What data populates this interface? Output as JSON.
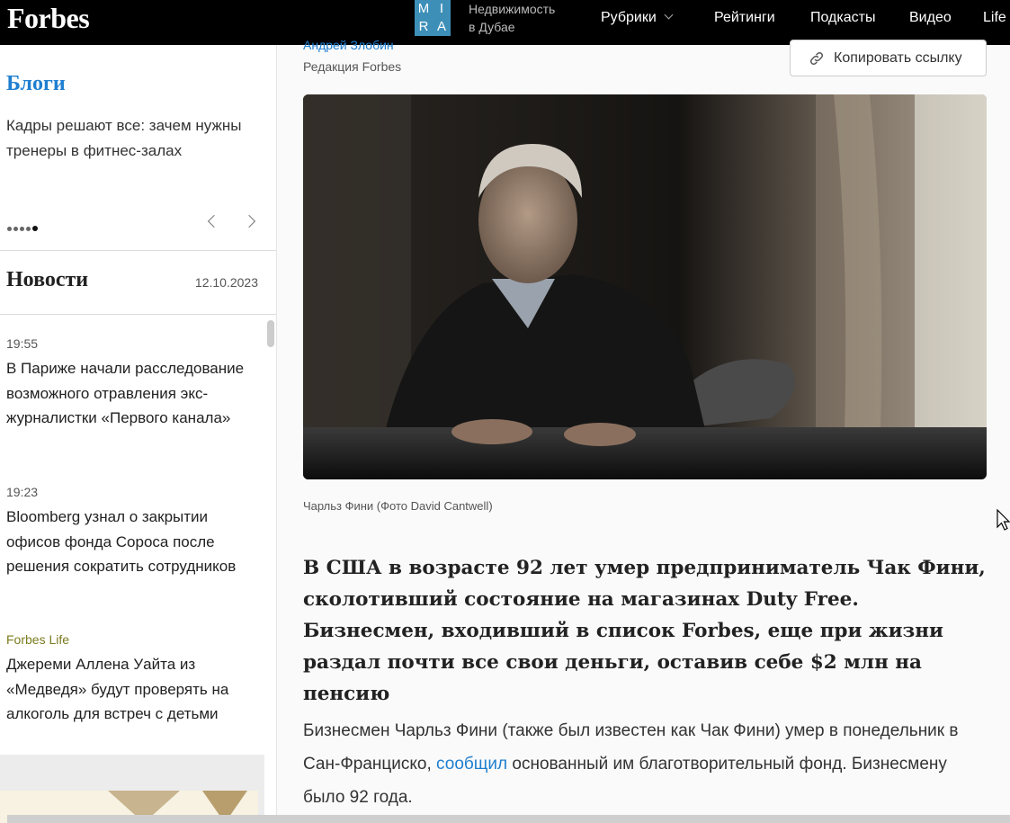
{
  "header": {
    "logo": "Forbes",
    "mira_letters": [
      "M",
      "I",
      "R",
      "A"
    ],
    "mira_line1": "Недвижимость",
    "mira_line2": "в Дубае",
    "nav": [
      {
        "label": "Рубрики",
        "has_dropdown": true
      },
      {
        "label": "Рейтинги"
      },
      {
        "label": "Подкасты"
      },
      {
        "label": "Видео"
      },
      {
        "label": "Life"
      }
    ]
  },
  "sidebar": {
    "blogs_title": "Блоги",
    "blogs_item": "Кадры решают все: зачем нужны тренеры в фитнес-залах",
    "news_title": "Новости",
    "news_date": "12.10.2023",
    "news": [
      {
        "time": "19:55",
        "title": "В Париже начали расследование возможного отравления экс-журналистки «Первого канала»"
      },
      {
        "time": "19:23",
        "title": "Bloomberg узнал о закрытии офисов фонда Сороса после решения сократить сотрудников"
      },
      {
        "time": "Forbes Life",
        "title": "Джереми Аллена Уайта из «Медведя» будут проверять на алкоголь для встреч с детьми"
      }
    ]
  },
  "article": {
    "author": "Андрей Злобин",
    "editorial": "Редакция Forbes",
    "copy_link": "Копировать ссылку",
    "caption": "Чарльз Фини (Фото David Cantwell)",
    "lead": "В США в возрасте 92 лет умер предприниматель Чак Фини, сколотивший состояние на магазинах Duty Free. Бизнесмен, входивший в список Forbes, еще при жизни раздал почти все свои деньги, оставив себе $2 млн на пенсию",
    "body_before": "Бизнесмен Чарльз Фини (также был известен как Чак Фини) умер в понедельник в Сан-Франциско, ",
    "body_link": "сообщил",
    "body_after": " основанный им благотворительный фонд. Бизнесмену было 92 года."
  },
  "colors": {
    "accent": "#1f7fd0",
    "topbar": "#000000",
    "mira": "#3d8fb8",
    "tag": "#7b7b1f"
  }
}
